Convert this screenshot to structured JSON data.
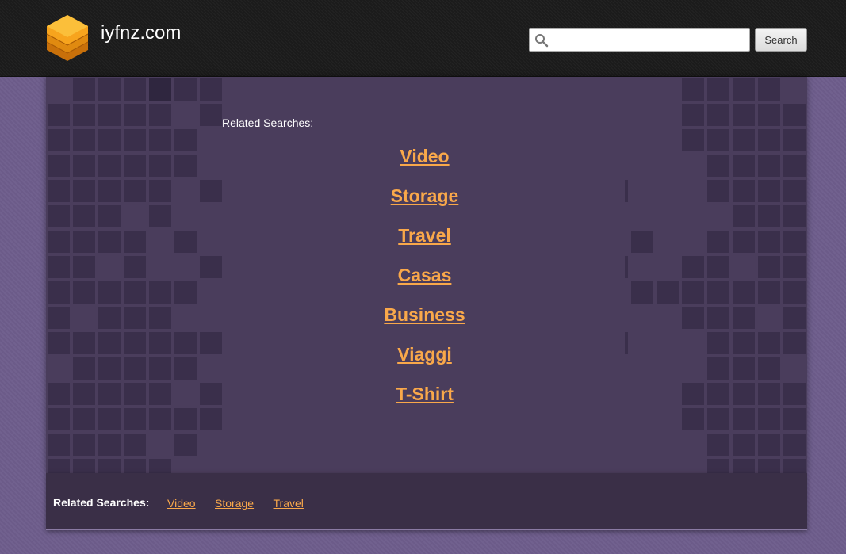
{
  "header": {
    "site_name": "iyfnz.com",
    "search_placeholder": "",
    "search_value": "",
    "search_button_label": "Search",
    "logo_icon": "stacked-layers-icon",
    "search_icon": "magnifier-icon"
  },
  "main": {
    "related_label": "Related Searches:",
    "links": [
      "Video",
      "Storage",
      "Travel",
      "Casas",
      "Business",
      "Viaggi",
      "T-Shirt"
    ]
  },
  "footer": {
    "related_label": "Related Searches:",
    "links": [
      "Video",
      "Storage",
      "Travel"
    ]
  },
  "colors": {
    "link": "#f9a84a",
    "panel": "#4a3d5c",
    "background": "#6e5d8c",
    "header": "#1c1c1c",
    "footer": "#3a2f47"
  }
}
